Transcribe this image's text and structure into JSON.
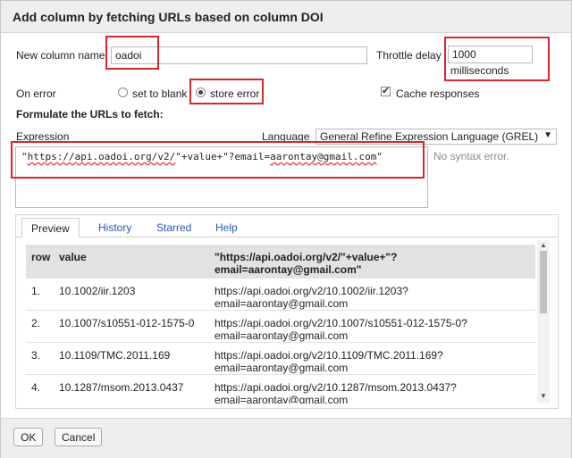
{
  "dialog": {
    "title": "Add column by fetching URLs based on column DOI"
  },
  "form": {
    "new_column_label": "New column name",
    "new_column_value": "oadoi",
    "throttle_label": "Throttle delay",
    "throttle_value": "1000",
    "throttle_unit": "milliseconds",
    "on_error_label": "On error",
    "set_to_blank_label": "set to blank",
    "store_error_label": "store error",
    "cache_label": "Cache responses",
    "formulate_label": "Formulate the URLs to fetch:",
    "expression_label": "Expression",
    "language_label": "Language",
    "language_value": "General Refine Expression Language (GREL)",
    "expression_prefix": "\"",
    "expression_url": "https://api.oadoi.org/v2/",
    "expression_rest": "\"+value+\"?email=",
    "expression_email": "aarontay@gmail.com",
    "expression_end": "\"",
    "syntax_status": "No syntax error."
  },
  "tabs": [
    {
      "label": "Preview"
    },
    {
      "label": "History"
    },
    {
      "label": "Starred"
    },
    {
      "label": "Help"
    }
  ],
  "table": {
    "headers": {
      "row": "row",
      "value": "value",
      "expr_line1": "\"https://api.oadoi.org/v2/\"+value+\"?",
      "expr_line2": "email=aarontay@gmail.com\""
    },
    "rows": [
      {
        "row": "1.",
        "value": "10.1002/iir.1203",
        "result1": "https://api.oadoi.org/v2/10.1002/iir.1203?",
        "result2": "email=aarontay@gmail.com"
      },
      {
        "row": "2.",
        "value": "10.1007/s10551-012-1575-0",
        "result1": "https://api.oadoi.org/v2/10.1007/s10551-012-1575-0?",
        "result2": "email=aarontay@gmail.com"
      },
      {
        "row": "3.",
        "value": "10.1109/TMC.2011.169",
        "result1": "https://api.oadoi.org/v2/10.1109/TMC.2011.169?",
        "result2": "email=aarontay@gmail.com"
      },
      {
        "row": "4.",
        "value": "10.1287/msom.2013.0437",
        "result1": "https://api.oadoi.org/v2/10.1287/msom.2013.0437?",
        "result2": "email=aarontay@gmail.com"
      }
    ]
  },
  "buttons": {
    "ok": "OK",
    "cancel": "Cancel"
  },
  "icons": {
    "checkmark": "✔",
    "dropdown_arrow": "▼",
    "scroll_up": "▲",
    "scroll_down": "▼"
  },
  "colors": {
    "highlight": "#d9262a",
    "link": "#2a57b5"
  }
}
